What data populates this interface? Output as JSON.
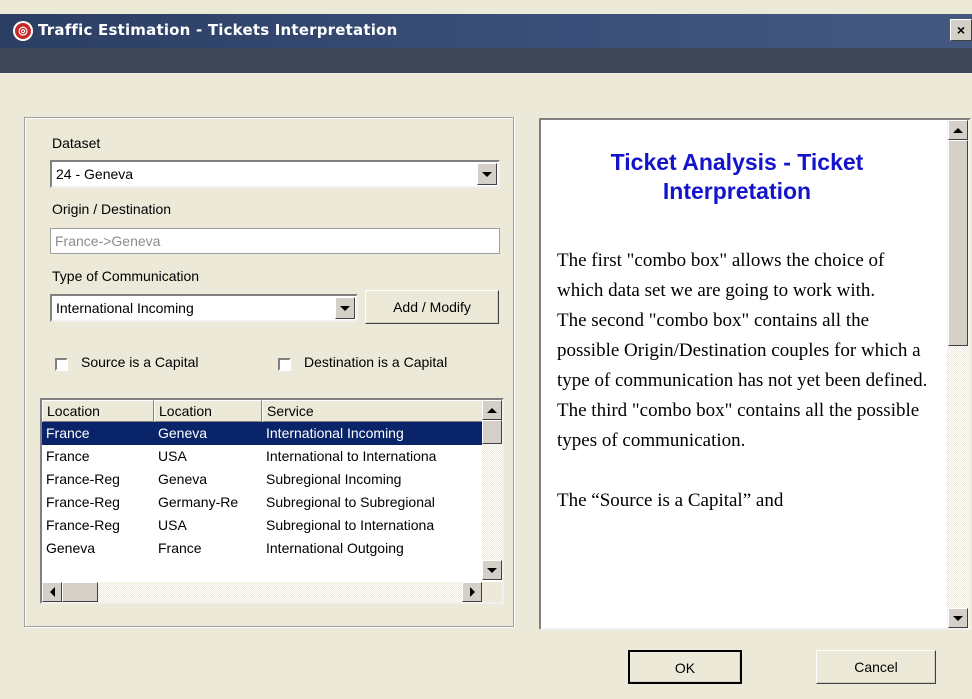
{
  "window": {
    "title": "Traffic Estimation - Tickets Interpretation",
    "close_label": "×"
  },
  "form": {
    "dataset_label": "Dataset",
    "dataset_value": "24 - Geneva",
    "od_label": "Origin / Destination",
    "od_value": "France->Geneva",
    "comm_label": "Type of Communication",
    "comm_value": "International Incoming",
    "add_modify_label": "Add / Modify",
    "source_capital_label": "Source is a Capital",
    "dest_capital_label": "Destination is a Capital"
  },
  "table": {
    "columns": [
      "Location",
      "Location",
      "Service"
    ],
    "rows": [
      [
        "France",
        "Geneva",
        "International Incoming"
      ],
      [
        "France",
        "USA",
        "International to Internationa"
      ],
      [
        "France-Reg",
        "Geneva",
        "Subregional Incoming"
      ],
      [
        "France-Reg",
        "Germany-Re",
        "Subregional to Subregional"
      ],
      [
        "France-Reg",
        "USA",
        "Subregional to Internationa"
      ],
      [
        "Geneva",
        "France",
        "International Outgoing"
      ]
    ],
    "selected_row": 0
  },
  "help": {
    "title": "Ticket Analysis - Ticket Interpretation",
    "paragraphs": [
      "The first \"combo box\" allows the choice of which data set we are going to work with.",
      "The second \"combo box\" contains all the possible Origin/Destination couples for which a type of communication has not yet been defined.",
      "The third \"combo box\" contains all the possible types of communication.",
      "The “Source is a Capital” and"
    ]
  },
  "buttons": {
    "ok_label": "OK",
    "cancel_label": "Cancel"
  },
  "colors": {
    "title_bar": "#2b3e63",
    "selection": "#0a246a",
    "help_title": "#1414cc"
  }
}
